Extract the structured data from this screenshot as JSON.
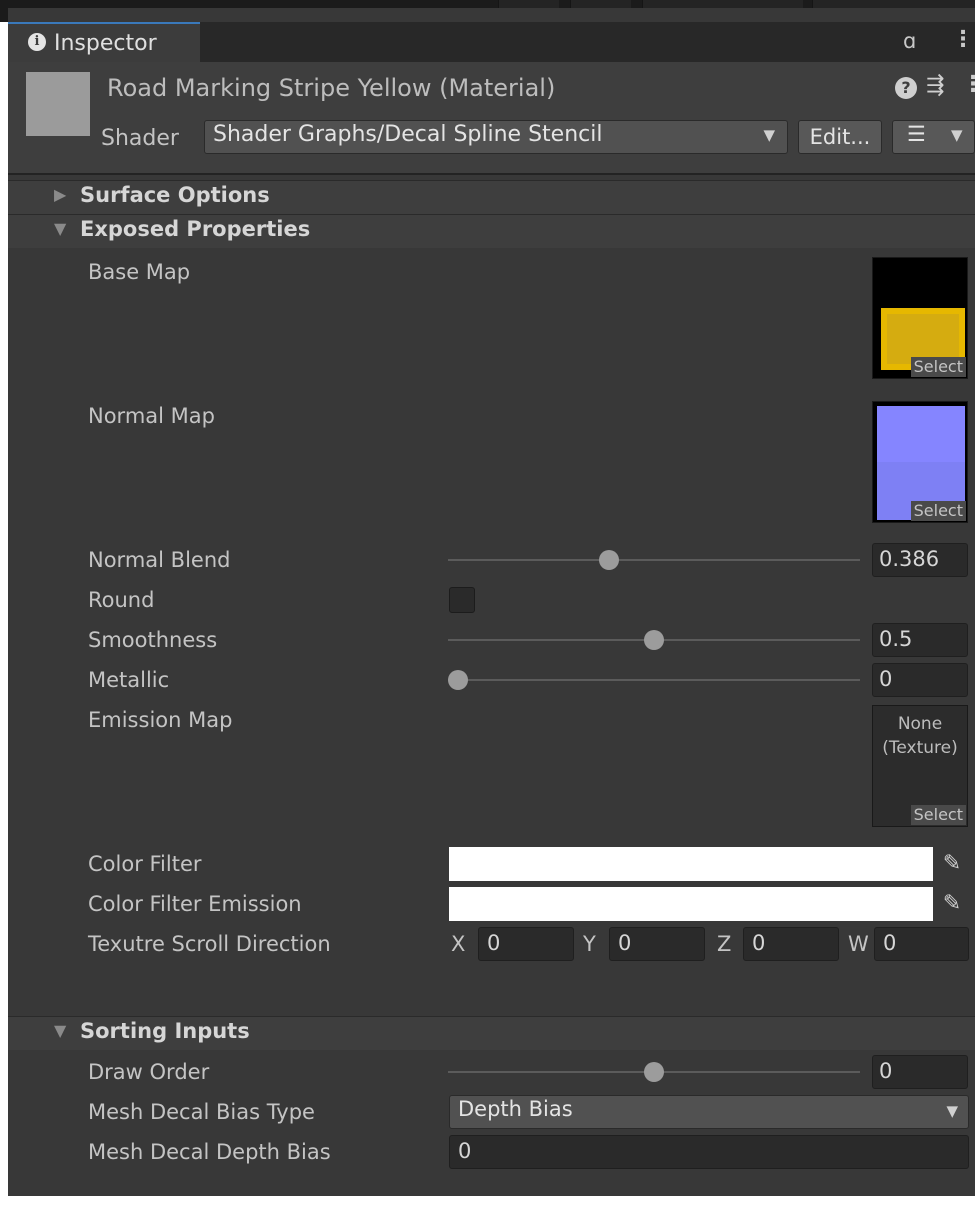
{
  "window": {
    "tab_label": "Inspector"
  },
  "icons": {
    "info": "info-icon",
    "lock": "lock-icon",
    "menu": "vertical-dots-icon",
    "help": "help-icon",
    "presets": "sliders-icon",
    "context": "vertical-dots-icon",
    "picker": "eyedropper-icon",
    "foldout_open": "triangle-down-icon",
    "foldout_closed": "triangle-right-icon"
  },
  "header": {
    "material_name": "Road Marking Stripe Yellow (Material)",
    "shader_label": "Shader",
    "shader_value": "Shader Graphs/Decal Spline Stencil",
    "edit_label": "Edit...",
    "list_glyph": "☰"
  },
  "sections": {
    "surface_options": {
      "title": "Surface Options",
      "expanded": false
    },
    "exposed_properties": {
      "title": "Exposed Properties",
      "expanded": true
    },
    "sorting_inputs": {
      "title": "Sorting Inputs",
      "expanded": true
    }
  },
  "props": {
    "base_map": {
      "label": "Base Map",
      "select": "Select"
    },
    "normal_map": {
      "label": "Normal Map",
      "select": "Select"
    },
    "normal_blend": {
      "label": "Normal Blend",
      "value": "0.386",
      "fraction": 0.386
    },
    "round": {
      "label": "Round",
      "checked": false
    },
    "smoothness": {
      "label": "Smoothness",
      "value": "0.5",
      "fraction": 0.5
    },
    "metallic": {
      "label": "Metallic",
      "value": "0",
      "fraction": 0.0
    },
    "emission_map": {
      "label": "Emission Map",
      "none_line1": "None",
      "none_line2": "(Texture)",
      "select": "Select"
    },
    "color_filter": {
      "label": "Color Filter",
      "color": "#ffffff"
    },
    "color_filter_emission": {
      "label": "Color Filter Emission",
      "color": "#ffffff"
    },
    "scroll_direction": {
      "label": "Texutre Scroll Direction",
      "x_label": "X",
      "x": "0",
      "y_label": "Y",
      "y": "0",
      "z_label": "Z",
      "z": "0",
      "w_label": "W",
      "w": "0"
    }
  },
  "sorting": {
    "draw_order": {
      "label": "Draw Order",
      "value": "0",
      "fraction": 0.5
    },
    "bias_type": {
      "label": "Mesh Decal Bias Type",
      "value": "Depth Bias"
    },
    "depth_bias": {
      "label": "Mesh Decal Depth Bias",
      "value": "0"
    }
  },
  "colors": {
    "panel_bg": "#383838",
    "header_bg": "#3e3e3e",
    "tab_accent": "#3a79bb",
    "base_map_yellow": "#e6b800",
    "normal_map_blue": "#8585ff"
  }
}
